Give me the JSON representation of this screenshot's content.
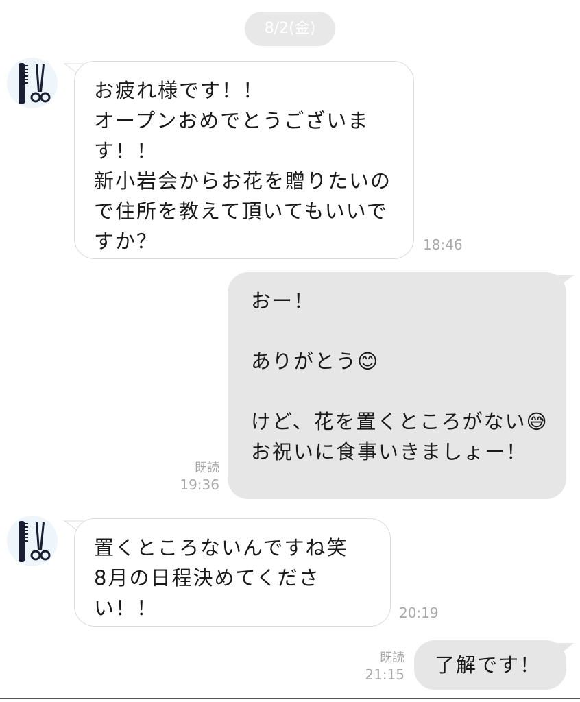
{
  "chat": {
    "date_separator": "8/2(金)",
    "messages": [
      {
        "direction": "incoming",
        "sender_avatar": "hair-salon-icon",
        "text": "お疲れ様です！！\nオープンおめでとうございます！！\n新小岩会からお花を贈りたいので住所を教えて頂いてもいいですか？",
        "time": "18:46"
      },
      {
        "direction": "outgoing",
        "text": "おー！\n\nありがとう😊\n\nけど、花を置くところがない😅\nお祝いに食事いきましょー！",
        "read": "既読",
        "time": "19:36"
      },
      {
        "direction": "incoming",
        "sender_avatar": "hair-salon-icon",
        "text": "置くところないんですね笑\n8月の日程決めてください！！",
        "time": "20:19"
      },
      {
        "direction": "outgoing",
        "text": "了解です！",
        "read": "既読",
        "time": "21:15"
      }
    ]
  }
}
